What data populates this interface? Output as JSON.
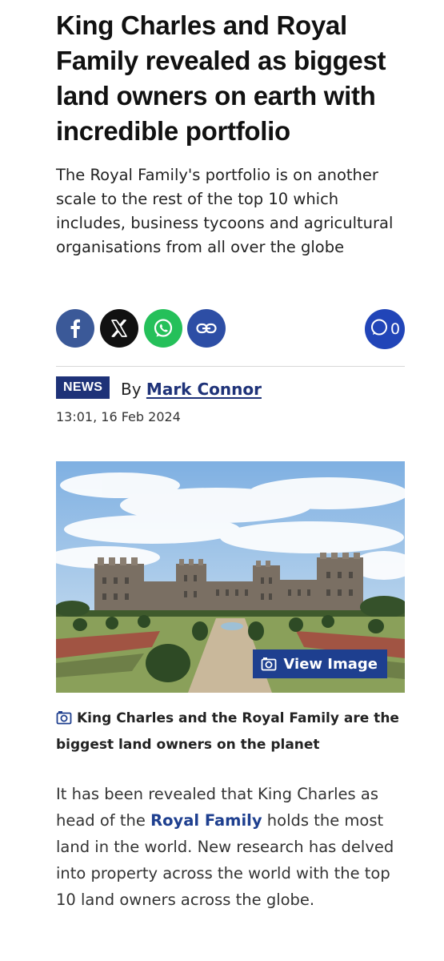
{
  "article": {
    "headline": "King Charles and Royal Family revealed as biggest land owners on earth with incredible portfolio",
    "standfirst": "The Royal Family's portfolio is on another scale to the rest of the top 10 which includes, business tycoons and agricultural organisations from all over the globe",
    "category": "NEWS",
    "by_label": "By",
    "author": "Mark Connor",
    "timestamp": "13:01, 16 Feb 2024"
  },
  "share": {
    "buttons": [
      {
        "name": "facebook",
        "icon": "facebook-icon",
        "color": "#3b5998"
      },
      {
        "name": "x",
        "icon": "x-icon",
        "color": "#111111"
      },
      {
        "name": "whatsapp",
        "icon": "whatsapp-icon",
        "color": "#25c05a"
      },
      {
        "name": "copy-link",
        "icon": "link-icon",
        "color": "#2d4ea5"
      }
    ],
    "comment_count": "0"
  },
  "media": {
    "view_image_label": "View Image",
    "caption": "King Charles and the Royal Family are the biggest land owners on the planet"
  },
  "body": {
    "p1_before": "It has been revealed that King Charles as head of the ",
    "p1_link": "Royal Family",
    "p1_after": " holds the most land in the world. New research has delved into property across the world with the top 10 land owners across the globe."
  },
  "colors": {
    "brand_navy": "#1e3278",
    "link_blue": "#1e3f8f",
    "comment_blue": "#2145b8"
  }
}
